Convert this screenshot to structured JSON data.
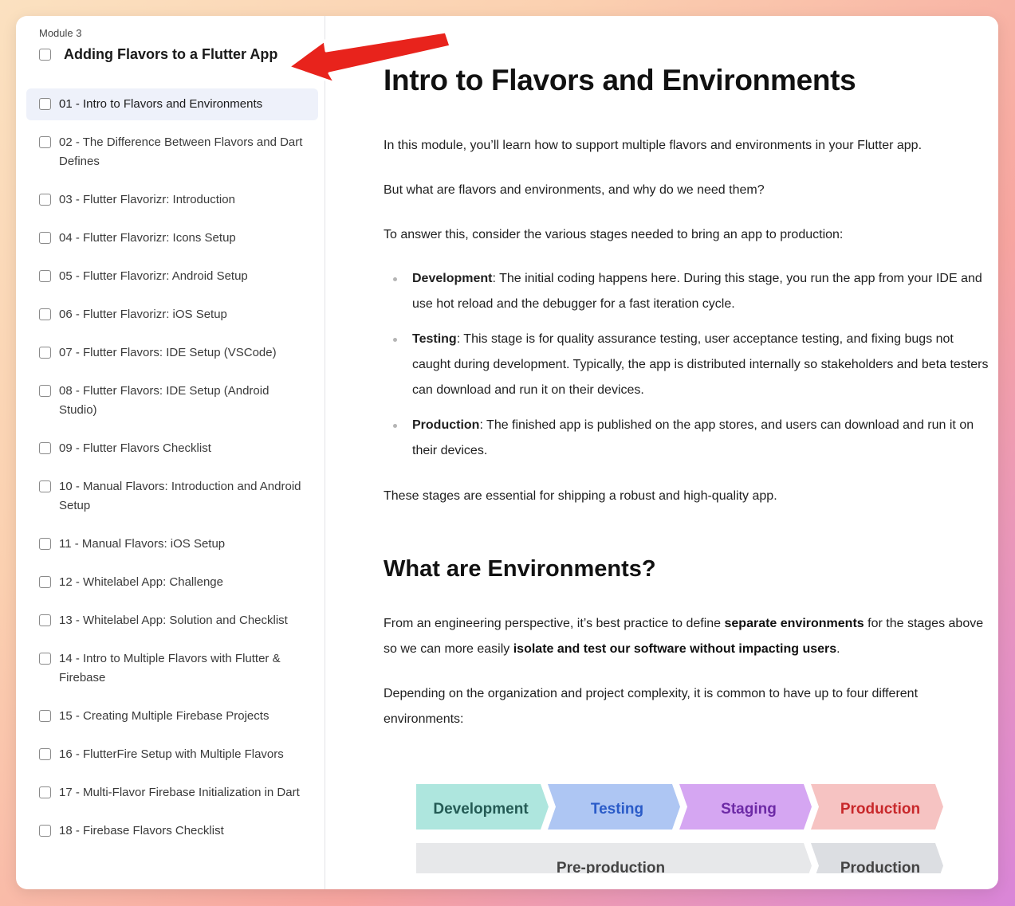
{
  "sidebar": {
    "module_label": "Module 3",
    "module_title": "Adding Flavors to a Flutter App",
    "lessons": [
      {
        "label": "01 - Intro to Flavors and Environments"
      },
      {
        "label": "02 - The Difference Between Flavors and Dart Defines"
      },
      {
        "label": "03 - Flutter Flavorizr: Introduction"
      },
      {
        "label": "04 - Flutter Flavorizr: Icons Setup"
      },
      {
        "label": "05 - Flutter Flavorizr: Android Setup"
      },
      {
        "label": "06 - Flutter Flavorizr: iOS Setup"
      },
      {
        "label": "07 - Flutter Flavors: IDE Setup (VSCode)"
      },
      {
        "label": "08 - Flutter Flavors: IDE Setup (Android Studio)"
      },
      {
        "label": "09 - Flutter Flavors Checklist"
      },
      {
        "label": "10 - Manual Flavors: Introduction and Android Setup"
      },
      {
        "label": "11 - Manual Flavors: iOS Setup"
      },
      {
        "label": "12 - Whitelabel App: Challenge"
      },
      {
        "label": "13 - Whitelabel App: Solution and Checklist"
      },
      {
        "label": "14 - Intro to Multiple Flavors with Flutter & Firebase"
      },
      {
        "label": "15 - Creating Multiple Firebase Projects"
      },
      {
        "label": "16 - FlutterFire Setup with Multiple Flavors"
      },
      {
        "label": "17 - Multi-Flavor Firebase Initialization in Dart"
      },
      {
        "label": "18 - Firebase Flavors Checklist"
      }
    ]
  },
  "content": {
    "title": "Intro to Flavors and Environments",
    "p1": "In this module, you’ll learn how to support multiple flavors and environments in your Flutter app.",
    "p2": "But what are flavors and environments, and why do we need them?",
    "p3": "To answer this, consider the various stages needed to bring an app to production:",
    "bullets": [
      {
        "term": "Development",
        "text": ": The initial coding happens here. During this stage, you run the app from your IDE and use hot reload and the debugger for a fast iteration cycle."
      },
      {
        "term": "Testing",
        "text": ": This stage is for quality assurance testing, user acceptance testing, and fixing bugs not caught during development. Typically, the app is distributed internally so stakeholders and beta testers can download and run it on their devices."
      },
      {
        "term": "Production",
        "text": ": The finished app is published on the app stores, and users can download and run it on their devices."
      }
    ],
    "p4": "These stages are essential for shipping a robust and high-quality app.",
    "h2": "What are Environments?",
    "p5": {
      "a": "From an engineering perspective, it’s best practice to define ",
      "b": "separate environments",
      "c": " for the stages above so we can more easily ",
      "d": "isolate and test our software without impacting users",
      "e": "."
    },
    "p6": "Depending on the organization and project complexity, it is common to have up to four different environments:"
  },
  "diagram": {
    "stages": [
      {
        "label": "Development",
        "fill": "#aee6de",
        "text": "#245b55"
      },
      {
        "label": "Testing",
        "fill": "#aec6f3",
        "text": "#2a5bc8"
      },
      {
        "label": "Staging",
        "fill": "#d5a6f2",
        "text": "#6d2aa6"
      },
      {
        "label": "Production",
        "fill": "#f6c3c2",
        "text": "#c8282b"
      }
    ],
    "groups": [
      {
        "label": "Pre-production",
        "fill": "#e7e8ea",
        "text": "#444"
      },
      {
        "label": "Production",
        "fill": "#dcdee2",
        "text": "#444"
      }
    ]
  },
  "annotation": {
    "arrow_color": "#e8231c"
  }
}
